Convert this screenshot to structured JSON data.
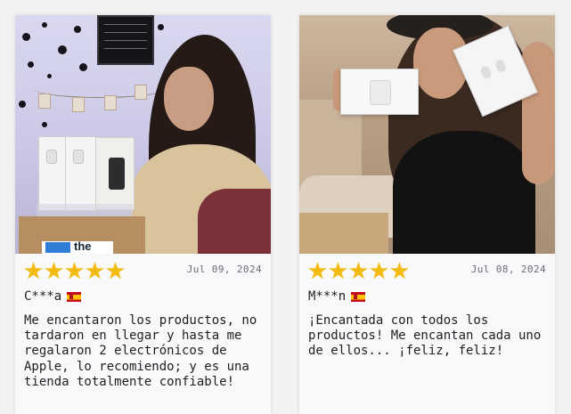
{
  "reviews": [
    {
      "rating": 5,
      "date": "Jul 09, 2024",
      "author": "C***a",
      "country_flag": "spain-flag-icon",
      "text": "Me encantaron los productos, no tardaron en llegar y hasta me regalaron 2 electrónicos de Apple, lo recomiendo; y es una tienda totalmente confiable!",
      "photo_label": "the"
    },
    {
      "rating": 5,
      "date": "Jul 08, 2024",
      "author": "M***n",
      "country_flag": "spain-flag-icon",
      "text": "¡Encantada con todos los productos! Me encantan cada uno de ellos... ¡feliz, feliz!"
    }
  ],
  "colors": {
    "star": "#f3ba12",
    "card_bg": "#f9f9fb",
    "page_bg": "#f2f2f4"
  }
}
